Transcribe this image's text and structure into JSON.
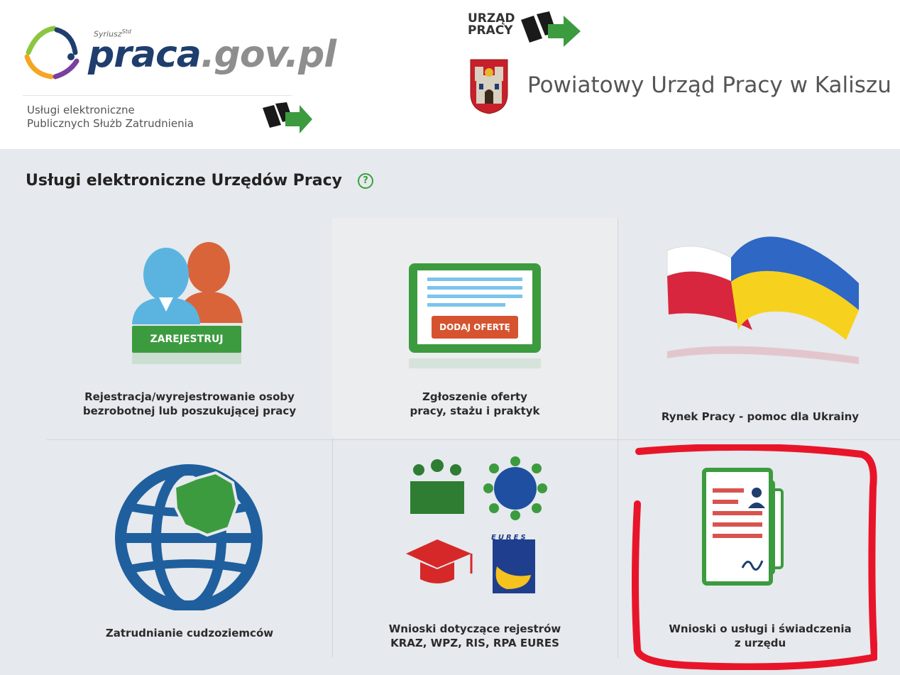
{
  "header": {
    "brand_super": "Syriusz",
    "brand_super_sup": "Std",
    "brand_name": "praca",
    "brand_domain": ".gov.pl",
    "subtitle_line1": "Usługi elektroniczne",
    "subtitle_line2": "Publicznych Służb Zatrudnienia",
    "up_logo_line1": "URZĄD",
    "up_logo_line2": "PRACY",
    "office_name": "Powiatowy Urząd Pracy w Kaliszu"
  },
  "panel": {
    "title": "Usługi elektroniczne Urzędów Pracy",
    "help_glyph": "?",
    "tiles": [
      {
        "icon": "people-icon",
        "button": "ZAREJESTRUJ",
        "line1": "Rejestracja/wyrejestrowanie osoby",
        "line2": "bezrobotnej lub poszukującej pracy"
      },
      {
        "icon": "job-offer-icon",
        "button": "DODAJ OFERTĘ",
        "line1": "Zgłoszenie oferty",
        "line2": "pracy, stażu i praktyk"
      },
      {
        "icon": "flags-icon",
        "line1": "Rynek Pracy - pomoc dla Ukrainy"
      },
      {
        "icon": "globe-icon",
        "line1": "Zatrudnianie cudzoziemców"
      },
      {
        "icon": "registries-icon",
        "eures_text": "EURES",
        "line1": "Wnioski dotyczące rejestrów",
        "line2": "KRAZ, WPZ, RIS, RPA EURES"
      },
      {
        "icon": "documents-icon",
        "line1": "Wnioski o usługi i świadczenia",
        "line2": "z urzędu"
      }
    ]
  },
  "colors": {
    "brand_blue": "#1f3e6e",
    "green": "#3c9b3f",
    "orange_red": "#d5532f",
    "panel_bg": "#e6e9ed",
    "highlight_red": "#e8152a"
  }
}
